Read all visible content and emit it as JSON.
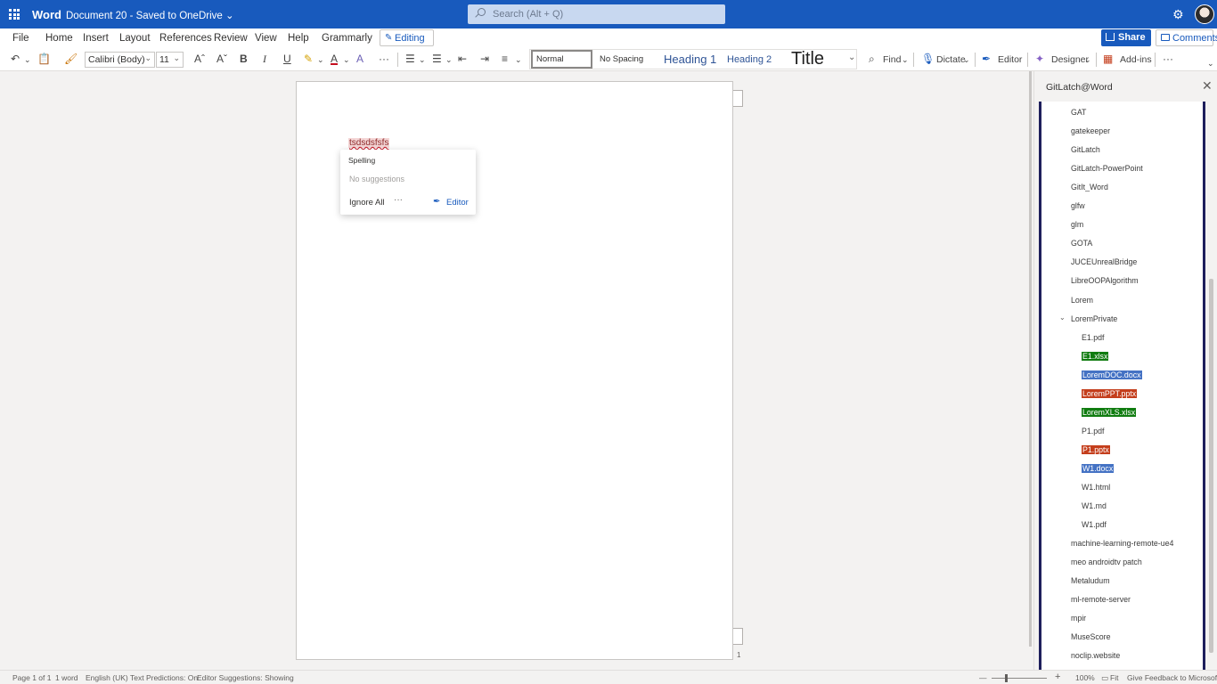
{
  "titlebar": {
    "app_name": "Word",
    "doc_name": "Document 20 - Saved to OneDrive ⌄",
    "search_placeholder": "Search (Alt + Q)"
  },
  "ribbon_tabs": [
    "File",
    "Home",
    "Insert",
    "Layout",
    "References",
    "Review",
    "View",
    "Help",
    "Grammarly"
  ],
  "active_tab": "Home",
  "ribbon_right": {
    "editing": "Editing ⌄",
    "share": "Share ⌄",
    "comments": "Comments"
  },
  "toolbar": {
    "undo": "↶",
    "font_name": "Calibri (Body)",
    "font_size": "11",
    "grow": "Aˆ",
    "shrink": "Aˇ",
    "bold": "B",
    "italic": "I",
    "underline": "U",
    "font_color": "A",
    "more": "···",
    "styles": {
      "normal": "Normal",
      "no_spacing": "No Spacing",
      "heading1": "Heading 1",
      "heading2": "Heading 2",
      "title": "Title"
    },
    "find": "Find",
    "dictate": "Dictate",
    "editor": "Editor",
    "designer": "Designer",
    "addins": "Add-ins"
  },
  "document": {
    "misspelled_word": "tsdsdsfsfs",
    "page_number": "1"
  },
  "spelling_popup": {
    "title": "Spelling",
    "no_suggestions": "No suggestions",
    "ignore_all": "Ignore All",
    "more": "···",
    "editor": "Editor"
  },
  "side_pane": {
    "title": "GitLatch@Word",
    "items": [
      {
        "label": "GAT",
        "level": 0
      },
      {
        "label": "gatekeeper",
        "level": 0
      },
      {
        "label": "GitLatch",
        "level": 0
      },
      {
        "label": "GitLatch-PowerPoint",
        "level": 0
      },
      {
        "label": "GitIt_Word",
        "level": 0
      },
      {
        "label": "glfw",
        "level": 0
      },
      {
        "label": "glm",
        "level": 0
      },
      {
        "label": "GOTA",
        "level": 0
      },
      {
        "label": "JUCEUnrealBridge",
        "level": 0
      },
      {
        "label": "LibreOOPAlgorithm",
        "level": 0
      },
      {
        "label": "Lorem",
        "level": 0
      },
      {
        "label": "LoremPrivate",
        "level": 0,
        "expanded": true
      },
      {
        "label": "E1.pdf",
        "level": 1
      },
      {
        "label": "E1.xlsx",
        "level": 1,
        "color": "#107c10"
      },
      {
        "label": "LoremDOC.docx",
        "level": 1,
        "color": "#4472c4"
      },
      {
        "label": "LoremPPT.pptx",
        "level": 1,
        "color": "#c43e1c"
      },
      {
        "label": "LoremXLS.xlsx",
        "level": 1,
        "color": "#107c10"
      },
      {
        "label": "P1.pdf",
        "level": 1
      },
      {
        "label": "P1.pptx",
        "level": 1,
        "color": "#c43e1c"
      },
      {
        "label": "W1.docx",
        "level": 1,
        "color": "#4472c4"
      },
      {
        "label": "W1.html",
        "level": 1
      },
      {
        "label": "W1.md",
        "level": 1
      },
      {
        "label": "W1.pdf",
        "level": 1
      },
      {
        "label": "machine-learning-remote-ue4",
        "level": 0
      },
      {
        "label": "meo androidtv patch",
        "level": 0
      },
      {
        "label": "Metaludum",
        "level": 0
      },
      {
        "label": "ml-remote-server",
        "level": 0
      },
      {
        "label": "mpir",
        "level": 0
      },
      {
        "label": "MuseScore",
        "level": 0
      },
      {
        "label": "noclip.website",
        "level": 0
      }
    ]
  },
  "statusbar": {
    "page": "Page 1 of 1",
    "words": "1 word",
    "language": "English (UK)",
    "predictions": "Text Predictions: On",
    "editor_suggestions": "Editor Suggestions: Showing",
    "zoom_out": "—",
    "zoom_in": "+",
    "zoom": "100%",
    "fit": "Fit",
    "feedback": "Give Feedback to Microsoft"
  },
  "colors": {
    "brand": "#185abd",
    "pane_border": "#1e1f5c"
  }
}
